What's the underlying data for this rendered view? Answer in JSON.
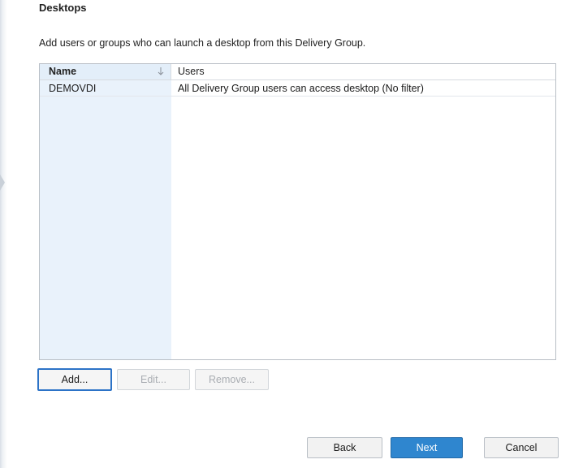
{
  "page": {
    "title": "Desktops",
    "instructions": "Add users or groups who can launch a desktop from this Delivery Group."
  },
  "grid": {
    "columns": {
      "name": "Name",
      "users": "Users"
    },
    "sort_icon": "sort-descending-arrow-icon",
    "rows": [
      {
        "name": "DEMOVDI",
        "users": "All Delivery Group users can access desktop (No filter)"
      }
    ]
  },
  "row_actions": {
    "add_label": "Add...",
    "edit_label": "Edit...",
    "remove_label": "Remove..."
  },
  "wizard_nav": {
    "back_label": "Back",
    "next_label": "Next",
    "cancel_label": "Cancel"
  },
  "colors": {
    "accent": "#2f86cf",
    "focus_border": "#2c73c7",
    "name_column_bg": "#e9f2fb"
  }
}
